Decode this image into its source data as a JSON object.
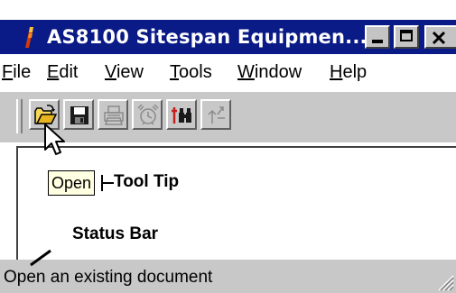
{
  "window": {
    "title": "AS8100 Sitespan Equipmen...",
    "controls": {
      "minimize": "minimize",
      "maximize": "maximize",
      "close": "close"
    }
  },
  "menu": {
    "items": [
      {
        "mnemonic": "F",
        "rest": "ile"
      },
      {
        "mnemonic": "E",
        "rest": "dit"
      },
      {
        "mnemonic": "V",
        "rest": "iew"
      },
      {
        "mnemonic": "T",
        "rest": "ools"
      },
      {
        "mnemonic": "W",
        "rest": "indow"
      },
      {
        "mnemonic": "H",
        "rest": "elp"
      }
    ]
  },
  "toolbar": {
    "buttons": [
      {
        "icon": "open-folder-icon",
        "enabled": true
      },
      {
        "icon": "save-disk-icon",
        "enabled": true
      },
      {
        "icon": "printer-icon",
        "enabled": false
      },
      {
        "icon": "alarm-clock-icon",
        "enabled": false
      },
      {
        "icon": "binoculars-icon",
        "enabled": true
      },
      {
        "icon": "connect-icon",
        "enabled": false
      }
    ]
  },
  "tooltip": {
    "text": "Open"
  },
  "annotations": {
    "tooltip_label": "Tool Tip",
    "statusbar_label": "Status Bar"
  },
  "statusbar": {
    "text": "Open an existing document"
  },
  "colors": {
    "titlebar": "#0a1a86",
    "face": "#c8c8c8",
    "tooltip_bg": "#ffffe1",
    "disabled_icon": "#8a8a8a"
  }
}
